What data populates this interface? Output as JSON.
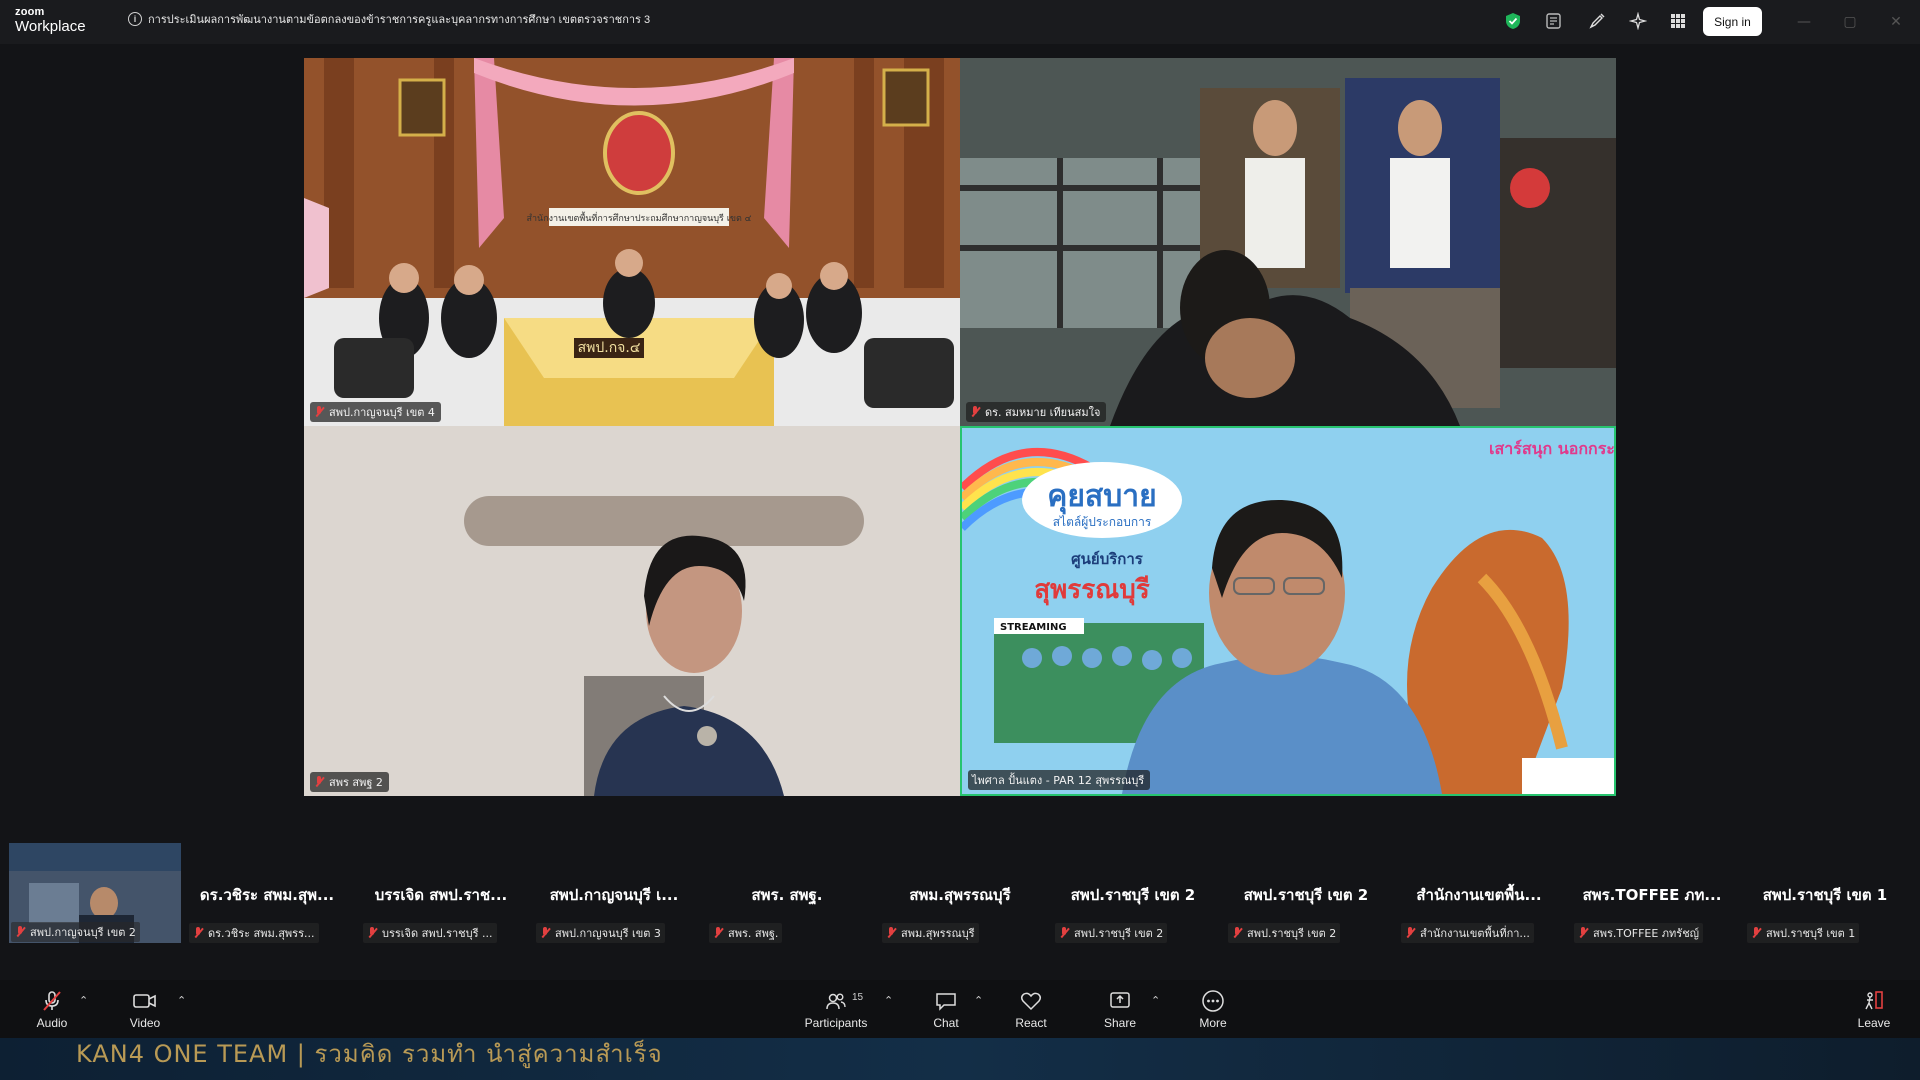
{
  "app": {
    "logo_line1": "zoom",
    "logo_line2": "Workplace"
  },
  "meeting": {
    "topic": "การประเมินผลการพัฒนางานตามข้อตกลงของข้าราชการครูและบุคลากรทางการศึกษา เขตตรวจราชการ 3"
  },
  "topbar": {
    "signin_label": "Sign in"
  },
  "tiles": [
    {
      "name": "สพป.กาญจนบุรี เขต 4",
      "scene_sign": "สำนักงานเขตพื้นที่การศึกษาประถมศึกษากาญจนบุรี เขต ๔",
      "desk_sign": "สพป.กจ.๔"
    },
    {
      "name": "ดร. สมหมาย  เทียนสมใจ"
    },
    {
      "name": "สพร สพฐ 2"
    },
    {
      "name": "ไพศาล ปั้นแตง - PAR 12 สุพรรณบุรี",
      "poster_title": "คุยสบาย",
      "poster_sub": "สไตล์ผู้ประกอบการ",
      "poster_center": "ศูนย์บริการ",
      "poster_city": "สุพรรณบุรี",
      "poster_streaming": "STREAMING",
      "poster_corner": "เสาร์สนุก นอกกระแส"
    }
  ],
  "strip": {
    "first": {
      "name": "สพป.กาญจนบุรี เขต 2"
    },
    "items": [
      {
        "big": "ดร.วชิระ สพม.สุพ...",
        "small": "ดร.วชิระ สพม.สุพรร..."
      },
      {
        "big": "บรรเจิด สพป.ราช...",
        "small": "บรรเจิด สพป.ราชบุรี ..."
      },
      {
        "big": "สพป.กาญจนบุรี เ...",
        "small": "สพป.กาญจนบุรี เขต 3"
      },
      {
        "big": "สพร. สพฐ.",
        "small": "สพร. สพฐ."
      },
      {
        "big": "สพม.สุพรรณบุรี",
        "small": "สพม.สุพรรณบุรี"
      },
      {
        "big": "สพป.ราชบุรี เขต 2",
        "small": "สพป.ราชบุรี เขต 2"
      },
      {
        "big": "สพป.ราชบุรี เขต 2",
        "small": "สพป.ราชบุรี เขต 2"
      },
      {
        "big": "สำนักงานเขตพื้น...",
        "small": "สำนักงานเขตพื้นที่กา..."
      },
      {
        "big": "สพร.TOFFEE ภท...",
        "small": "สพร.TOFFEE ภทรัชญ์"
      },
      {
        "big": "สพป.ราชบุรี เขต 1",
        "small": "สพป.ราชบุรี เขต 1"
      }
    ]
  },
  "toolbar": {
    "audio": "Audio",
    "video": "Video",
    "participants": "Participants",
    "participants_count": "15",
    "chat": "Chat",
    "react": "React",
    "share": "Share",
    "more": "More",
    "leave": "Leave"
  },
  "background_banner": "KAN4 ONE TEAM  |  รวมคิด รวมทำ นำสู่ความสำเร็จ",
  "colors": {
    "active_speaker": "#27c46f",
    "muted": "#e34040",
    "shield": "#1fb65a"
  }
}
